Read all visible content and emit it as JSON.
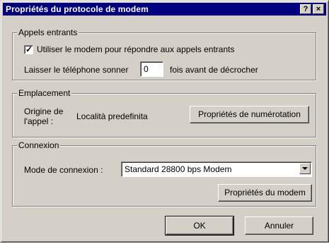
{
  "window": {
    "title": "Propriétés du protocole de modem",
    "help_glyph": "?",
    "close_glyph": "×"
  },
  "incoming": {
    "group_label": "Appels entrants",
    "checkbox_label": "Utiliser le modem pour répondre aux appels entrants",
    "checkbox_checked": true,
    "rings_before": "Laisser le téléphone sonner",
    "rings_value": "0",
    "rings_after": "fois avant de décrocher"
  },
  "location": {
    "group_label": "Emplacement",
    "origin_label_line1": "Origine de",
    "origin_label_line2": "l'appel :",
    "origin_value": "Località predefinita",
    "dialing_button": "Propriétés de numérotation"
  },
  "connection": {
    "group_label": "Connexion",
    "mode_label": "Mode de connexion :",
    "mode_value": "Standard 28800 bps Modem",
    "modem_button": "Propriétés du modem"
  },
  "footer": {
    "ok_button": "OK",
    "cancel_button": "Annuler"
  }
}
